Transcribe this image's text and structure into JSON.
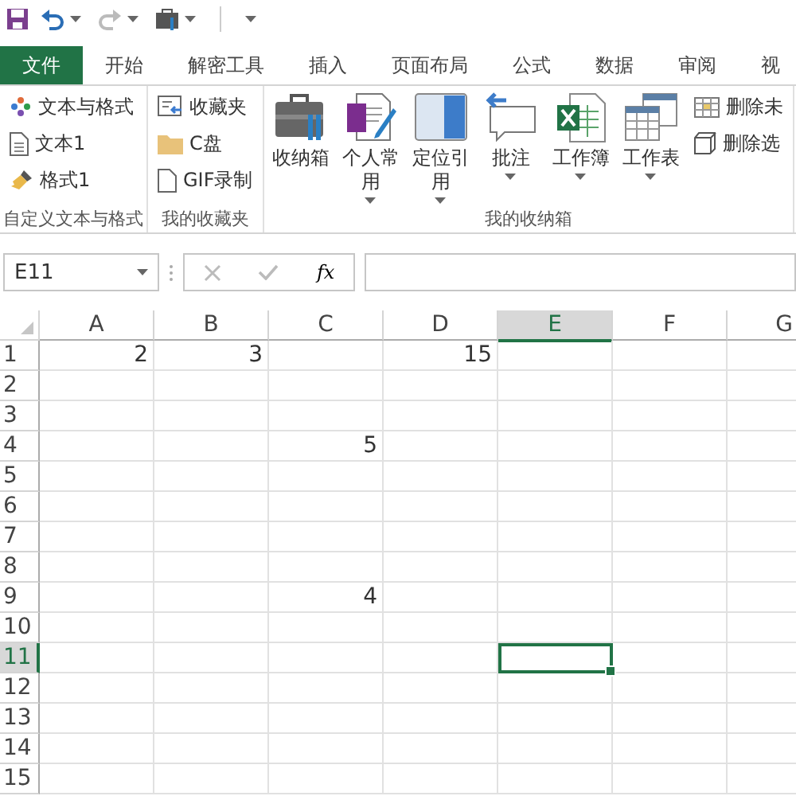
{
  "quick_access": {
    "redo_disabled": true
  },
  "tabs": [
    {
      "label": "文件",
      "selected": true,
      "kind": "file"
    },
    {
      "label": "开始",
      "selected": false,
      "kind": "tab"
    },
    {
      "label": "解密工具",
      "selected": false,
      "kind": "tab"
    },
    {
      "label": "插入",
      "selected": false,
      "kind": "tab"
    },
    {
      "label": "页面布局",
      "selected": false,
      "kind": "tab"
    },
    {
      "label": "公式",
      "selected": false,
      "kind": "tab"
    },
    {
      "label": "数据",
      "selected": false,
      "kind": "tab"
    },
    {
      "label": "审阅",
      "selected": false,
      "kind": "tab"
    },
    {
      "label": "视",
      "selected": false,
      "kind": "tab"
    }
  ],
  "ribbon_groups": [
    {
      "name": "自定义文本与格式",
      "items": [
        {
          "label": "文本与格式",
          "kind": "small"
        },
        {
          "label": "文本1",
          "kind": "small"
        },
        {
          "label": "格式1",
          "kind": "small"
        }
      ]
    },
    {
      "name": "我的收藏夹",
      "items": [
        {
          "label": "收藏夹",
          "kind": "small"
        },
        {
          "label": "C盘",
          "kind": "small"
        },
        {
          "label": "GIF录制",
          "kind": "small"
        }
      ]
    },
    {
      "name": "我的收纳箱",
      "items": [
        {
          "label": "收纳箱",
          "kind": "large",
          "has_menu": false
        },
        {
          "label": "个人常用",
          "kind": "large",
          "has_menu": true
        },
        {
          "label": "定位引用",
          "kind": "large",
          "has_menu": true
        },
        {
          "label": "批注",
          "kind": "large",
          "has_menu": true
        },
        {
          "label": "工作簿",
          "kind": "large",
          "has_menu": true
        },
        {
          "label": "工作表",
          "kind": "large",
          "has_menu": true
        },
        {
          "label": "删除未",
          "kind": "small"
        },
        {
          "label": "删除选",
          "kind": "small"
        }
      ]
    }
  ],
  "formula_bar": {
    "name_box": "E11",
    "function_label": "fx"
  },
  "sheet": {
    "columns": [
      {
        "label": "A",
        "selected": false
      },
      {
        "label": "B",
        "selected": false
      },
      {
        "label": "C",
        "selected": false
      },
      {
        "label": "D",
        "selected": false
      },
      {
        "label": "E",
        "selected": true
      },
      {
        "label": "F",
        "selected": false
      },
      {
        "label": "G",
        "selected": false
      }
    ],
    "rows": [
      {
        "label": "1",
        "selected": false,
        "cells": {
          "A": "2",
          "B": "3",
          "D": "15"
        }
      },
      {
        "label": "2",
        "selected": false
      },
      {
        "label": "3",
        "selected": false
      },
      {
        "label": "4",
        "selected": false,
        "cells": {
          "C": "5"
        }
      },
      {
        "label": "5",
        "selected": false
      },
      {
        "label": "6",
        "selected": false
      },
      {
        "label": "7",
        "selected": false
      },
      {
        "label": "8",
        "selected": false
      },
      {
        "label": "9",
        "selected": false,
        "cells": {
          "C": "4"
        }
      },
      {
        "label": "10",
        "selected": false
      },
      {
        "label": "11",
        "selected": true
      },
      {
        "label": "12",
        "selected": false
      },
      {
        "label": "13",
        "selected": false
      },
      {
        "label": "14",
        "selected": false
      },
      {
        "label": "15",
        "selected": false
      }
    ]
  }
}
